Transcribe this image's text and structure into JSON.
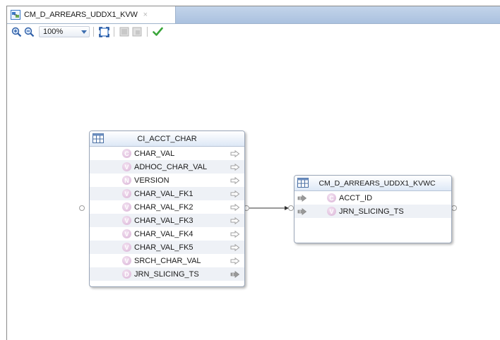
{
  "tab": {
    "title": "CM_D_ARREARS_UDDX1_KVW",
    "close_glyph": "×"
  },
  "toolbar": {
    "zoom_value": "100%",
    "buttons": [
      "zoom-in-icon",
      "zoom-out-icon",
      "fit-to-window-icon",
      "grid-disabled-icon",
      "layout-disabled-icon",
      "validate-checkmark-icon"
    ]
  },
  "source_table": {
    "name": "CI_ACCT_CHAR",
    "columns": [
      {
        "type": "C",
        "name": "CHAR_VAL",
        "arrow": "hollow"
      },
      {
        "type": "V",
        "name": "ADHOC_CHAR_VAL",
        "arrow": "hollow"
      },
      {
        "type": "N",
        "name": "VERSION",
        "arrow": "hollow"
      },
      {
        "type": "V",
        "name": "CHAR_VAL_FK1",
        "arrow": "hollow"
      },
      {
        "type": "V",
        "name": "CHAR_VAL_FK2",
        "arrow": "hollow"
      },
      {
        "type": "V",
        "name": "CHAR_VAL_FK3",
        "arrow": "hollow"
      },
      {
        "type": "V",
        "name": "CHAR_VAL_FK4",
        "arrow": "hollow"
      },
      {
        "type": "V",
        "name": "CHAR_VAL_FK5",
        "arrow": "hollow"
      },
      {
        "type": "V",
        "name": "SRCH_CHAR_VAL",
        "arrow": "hollow"
      },
      {
        "type": "D",
        "name": "JRN_SLICING_TS",
        "arrow": "filled"
      }
    ]
  },
  "target_table": {
    "name": "CM_D_ARREARS_UDDX1_KVWC",
    "columns": [
      {
        "type": "C",
        "name": "ACCT_ID"
      },
      {
        "type": "V",
        "name": "JRN_SLICING_TS"
      }
    ]
  },
  "colors": {
    "tab_bar": "#aac1df",
    "header_gradient_end": "#dde8f6",
    "column_icon": "#d9b3d6",
    "arrow_filled": "#9a9a9a",
    "checkmark": "#3aa53a"
  }
}
